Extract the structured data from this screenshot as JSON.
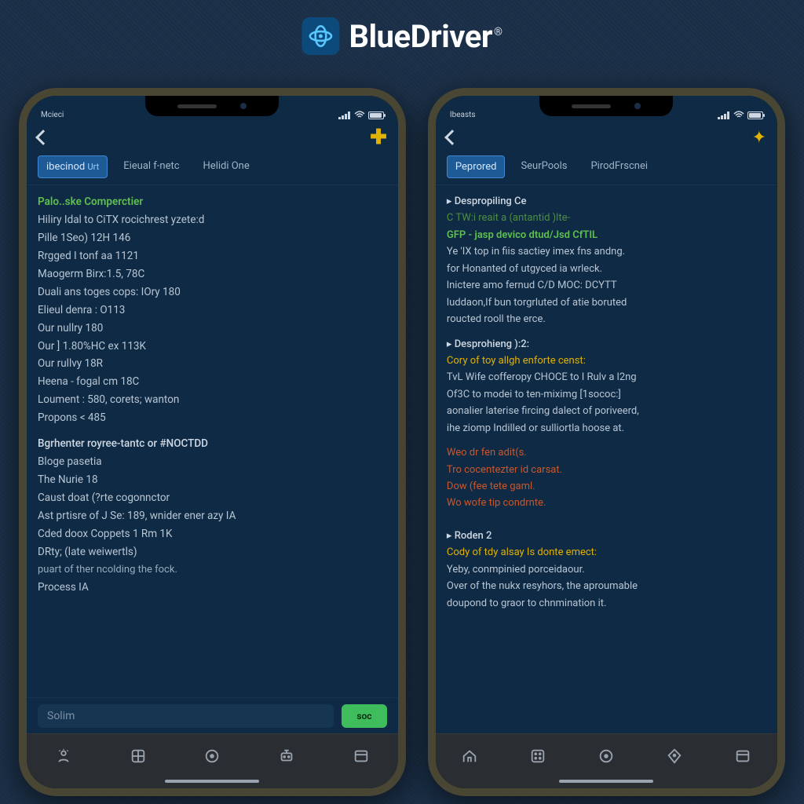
{
  "brand": {
    "name": "BlueDriver",
    "registered": "®"
  },
  "statusbar": {
    "left_label": "Mcieci",
    "right_label": "Ibeasts"
  },
  "phone_left": {
    "tabs": {
      "t0": "ibecinod",
      "t0_sub": "Urt",
      "t1": "Eieual f-netc",
      "t2": "Helidi One"
    },
    "header": "Palo..ske Comperctier",
    "lines": {
      "l0": "Hiliry Idal to CiTX rocichrest yzete:d",
      "l1": "Pille 1Seo) 12H 146",
      "l2": "Rrgged I tonf aa 1121",
      "l3": "Maogerm Birx:1.5, 78C",
      "l4": "Duali ans toges cops: IOry 180",
      "l5": "Elieul denra : O113",
      "l6": "Our nullry 180",
      "l7": "Our ] 1.80%HC ex 113K",
      "l8": "Our rullvy 18R",
      "l9": "Heena - fogal cm 18C",
      "l10": "Loument : 580, corets; wanton",
      "l11": "Propons < 485",
      "l12": "Bgrhenter royree-tantc or #NOCTDD",
      "l13": "Bloge pasetia",
      "l14": "The Nurie 18",
      "l15": "Caust doat (?rte cogonnctor",
      "l16": "Ast prtisre of J Se: 189, wnider ener azy IA",
      "l17": "Cded doox Coppets 1 Rm 1K",
      "l18": "DRty; (late weiwertls)",
      "l19": "puart of ther ncolding the fock.",
      "l20": "Process IA"
    },
    "search_placeholder": "Solim",
    "go_label": "soc"
  },
  "phone_right": {
    "tabs": {
      "t0": "Peprored",
      "t1": "SeurPools",
      "t2": "PirodFrscnei"
    },
    "sections": {
      "s1_h": "Despropiling Ce",
      "s1_g1": "C TW:i reait a (antantid )lte-",
      "s1_g2": "GFP - jasp devico dtud/Jsd CfTIL",
      "s1_p1": "Ye 'IX top in fiis sactiey imex fns andng.",
      "s1_p2": "for Honanted of utgyced ia wrleck.",
      "s1_p3": "lnictere amo fernud C/D MOC: DCYTT",
      "s1_p4": "luddaon,If bun torgrluted of atie boruted",
      "s1_p5": "roucted rooll the erce.",
      "s2_h": "Desprohieng ):2:",
      "s2_y": "Cory of toy allgh enforte censt:",
      "s2_p1": "TvL Wife cofferopy CHOCE to I Rulv a l2ng",
      "s2_p2": "Of3C to modei to ten-miximg [1sococ:]",
      "s2_p3": "aonalier laterise fircing dalect of poriveerd,",
      "s2_p4": "ihe ziomp Indilled or sulliortla hoose at.",
      "r1": "Weo dr fen adit(s.",
      "r2": "Tro cocentezter id carsat.",
      "r3": "Dow (fee tete gaml.",
      "r4": "Wo wofe tip condrnte.",
      "s3_h": "Roden 2",
      "s3_y": "Cody of tdy alsay Is donte emect:",
      "s3_p1": "Yeby, conmpinied porceidaour.",
      "s3_p2": "Over of the nukx resyhors, the aproumable",
      "s3_p3": "doupond to graor to chnmination it."
    }
  },
  "tabbar_icons": {
    "i1": "user-icon",
    "i2": "grid-icon",
    "i3": "circle-dot-icon",
    "i4": "diamond-icon",
    "i5": "panel-icon"
  }
}
